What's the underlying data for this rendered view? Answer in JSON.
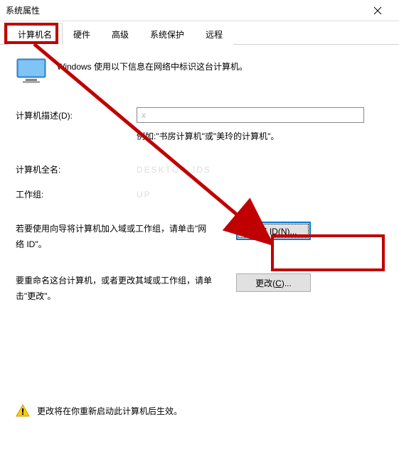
{
  "titlebar": {
    "title": "系统属性"
  },
  "tabs": {
    "items": [
      {
        "label": "计算机名"
      },
      {
        "label": "硬件"
      },
      {
        "label": "高级"
      },
      {
        "label": "系统保护"
      },
      {
        "label": "远程"
      }
    ]
  },
  "intro": "Windows 使用以下信息在网络中标识这台计算机。",
  "desc": {
    "label": "计算机描述(D):",
    "value": "x",
    "hint": "例如:\"书房计算机\"或\"美玲的计算机\"。"
  },
  "fullname": {
    "label": "计算机全名:",
    "value": "DESKTOP JDS"
  },
  "workgroup": {
    "label": "工作组:",
    "value": "UP"
  },
  "wizard": {
    "text": "若要使用向导将计算机加入域或工作组，请单击\"网络 ID\"。",
    "button_prefix": "网络 ID(",
    "button_key": "N",
    "button_suffix": ")..."
  },
  "rename": {
    "text": "要重命名这台计算机，或者更改其域或工作组，请单击\"更改\"。",
    "button_prefix": "更改(",
    "button_key": "C",
    "button_suffix": ")..."
  },
  "footer": "更改将在你重新启动此计算机后生效。"
}
